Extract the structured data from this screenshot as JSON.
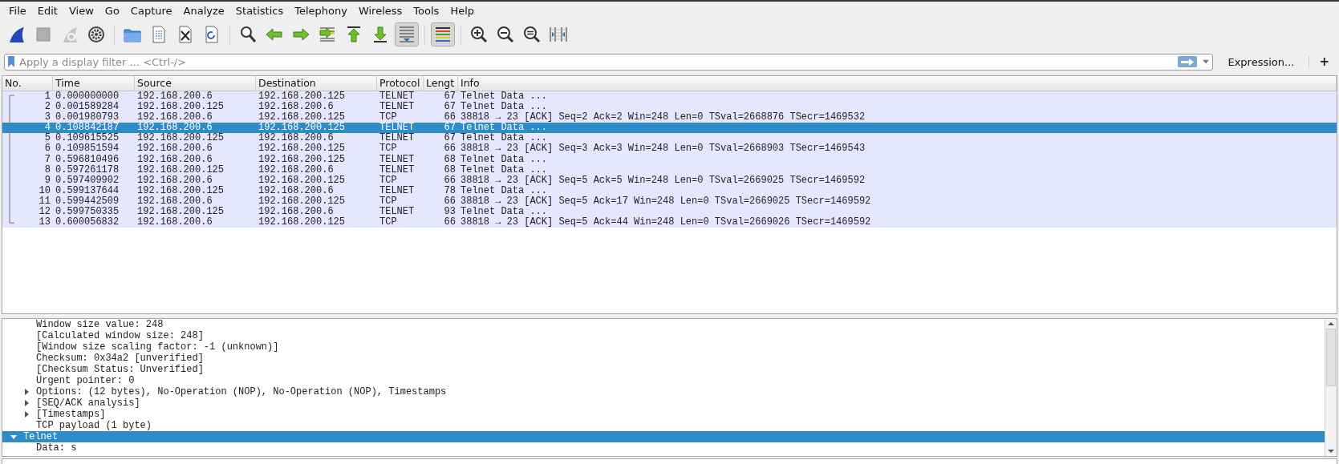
{
  "menu": [
    {
      "label": "File"
    },
    {
      "label": "Edit"
    },
    {
      "label": "View"
    },
    {
      "label": "Go"
    },
    {
      "label": "Capture"
    },
    {
      "label": "Analyze"
    },
    {
      "label": "Statistics"
    },
    {
      "label": "Telephony"
    },
    {
      "label": "Wireless"
    },
    {
      "label": "Tools"
    },
    {
      "label": "Help"
    }
  ],
  "toolbar": {
    "stop_disabled": true,
    "restart_disabled": true,
    "auto_scroll": true,
    "colorize": true
  },
  "filter": {
    "placeholder": "Apply a display filter ... <Ctrl-/>",
    "expression_button": "Expression...",
    "add_button": "+"
  },
  "packet_list": {
    "columns": [
      "No.",
      "Time",
      "Source",
      "Destination",
      "Protocol",
      "Lengt",
      "Info"
    ],
    "rows": [
      {
        "no": "1",
        "time": "0.000000000",
        "source": "192.168.200.6",
        "destination": "192.168.200.125",
        "protocol": "TELNET",
        "length": "67",
        "info": "Telnet Data ...",
        "selected": false
      },
      {
        "no": "2",
        "time": "0.001589284",
        "source": "192.168.200.125",
        "destination": "192.168.200.6",
        "protocol": "TELNET",
        "length": "67",
        "info": "Telnet Data ...",
        "selected": false
      },
      {
        "no": "3",
        "time": "0.001980793",
        "source": "192.168.200.6",
        "destination": "192.168.200.125",
        "protocol": "TCP",
        "length": "66",
        "info": "38818 → 23 [ACK] Seq=2 Ack=2 Win=248 Len=0 TSval=2668876 TSecr=1469532",
        "selected": false
      },
      {
        "no": "4",
        "time": "0.108842187",
        "source": "192.168.200.6",
        "destination": "192.168.200.125",
        "protocol": "TELNET",
        "length": "67",
        "info": "Telnet Data ...",
        "selected": true
      },
      {
        "no": "5",
        "time": "0.109615525",
        "source": "192.168.200.125",
        "destination": "192.168.200.6",
        "protocol": "TELNET",
        "length": "67",
        "info": "Telnet Data ...",
        "selected": false
      },
      {
        "no": "6",
        "time": "0.109851594",
        "source": "192.168.200.6",
        "destination": "192.168.200.125",
        "protocol": "TCP",
        "length": "66",
        "info": "38818 → 23 [ACK] Seq=3 Ack=3 Win=248 Len=0 TSval=2668903 TSecr=1469543",
        "selected": false
      },
      {
        "no": "7",
        "time": "0.596810496",
        "source": "192.168.200.6",
        "destination": "192.168.200.125",
        "protocol": "TELNET",
        "length": "68",
        "info": "Telnet Data ...",
        "selected": false
      },
      {
        "no": "8",
        "time": "0.597261178",
        "source": "192.168.200.125",
        "destination": "192.168.200.6",
        "protocol": "TELNET",
        "length": "68",
        "info": "Telnet Data ...",
        "selected": false
      },
      {
        "no": "9",
        "time": "0.597409902",
        "source": "192.168.200.6",
        "destination": "192.168.200.125",
        "protocol": "TCP",
        "length": "66",
        "info": "38818 → 23 [ACK] Seq=5 Ack=5 Win=248 Len=0 TSval=2669025 TSecr=1469592",
        "selected": false
      },
      {
        "no": "10",
        "time": "0.599137644",
        "source": "192.168.200.125",
        "destination": "192.168.200.6",
        "protocol": "TELNET",
        "length": "78",
        "info": "Telnet Data ...",
        "selected": false
      },
      {
        "no": "11",
        "time": "0.599442509",
        "source": "192.168.200.6",
        "destination": "192.168.200.125",
        "protocol": "TCP",
        "length": "66",
        "info": "38818 → 23 [ACK] Seq=5 Ack=17 Win=248 Len=0 TSval=2669025 TSecr=1469592",
        "selected": false
      },
      {
        "no": "12",
        "time": "0.599750335",
        "source": "192.168.200.125",
        "destination": "192.168.200.6",
        "protocol": "TELNET",
        "length": "93",
        "info": "Telnet Data ...",
        "selected": false
      },
      {
        "no": "13",
        "time": "0.600056832",
        "source": "192.168.200.6",
        "destination": "192.168.200.125",
        "protocol": "TCP",
        "length": "66",
        "info": "38818 → 23 [ACK] Seq=5 Ack=44 Win=248 Len=0 TSval=2669026 TSecr=1469592",
        "selected": false
      }
    ]
  },
  "details": {
    "scrolled_children": [
      {
        "text": "Window size value: 248"
      },
      {
        "text": "[Calculated window size: 248]"
      },
      {
        "text": "[Window size scaling factor: -1 (unknown)]"
      },
      {
        "text": "Checksum: 0x34a2 [unverified]"
      },
      {
        "text": "[Checksum Status: Unverified]"
      },
      {
        "text": "Urgent pointer: 0"
      },
      {
        "text": "Options: (12 bytes), No-Operation (NOP), No-Operation (NOP), Timestamps",
        "expanded": false
      },
      {
        "text": "[SEQ/ACK analysis]",
        "expanded": false
      },
      {
        "text": "[Timestamps]",
        "expanded": false
      },
      {
        "text": "TCP payload (1 byte)"
      }
    ],
    "nodes": [
      {
        "text": "Telnet",
        "expanded": true,
        "selected": true,
        "children": [
          {
            "text": "Data: s"
          }
        ]
      }
    ]
  }
}
